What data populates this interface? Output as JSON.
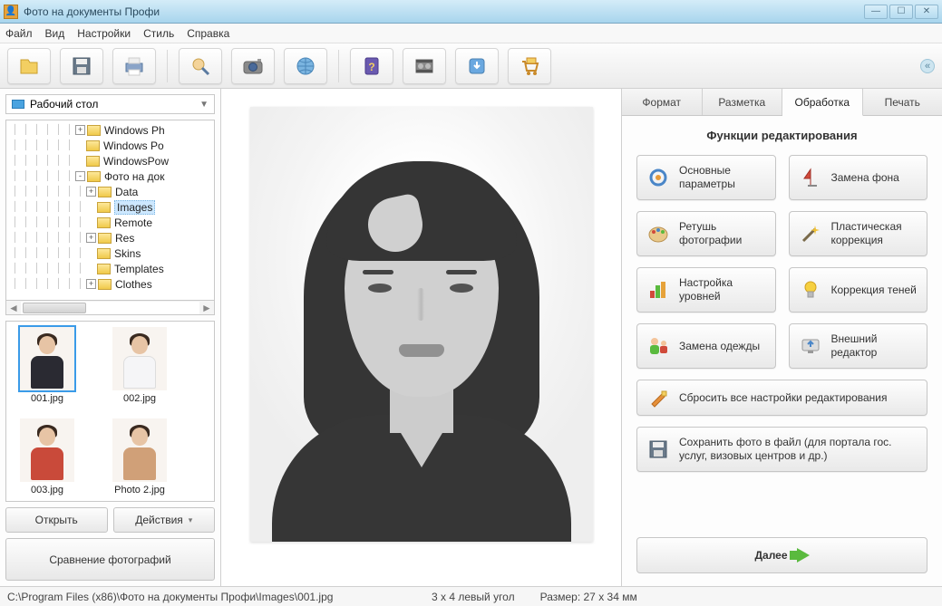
{
  "window": {
    "title": "Фото на документы Профи"
  },
  "menu": {
    "file": "Файл",
    "view": "Вид",
    "settings": "Настройки",
    "style": "Стиль",
    "help": "Справка"
  },
  "folder": {
    "label": "Рабочий стол"
  },
  "tree": [
    {
      "depth": 6,
      "exp": "+",
      "label": "Windows Ph"
    },
    {
      "depth": 6,
      "exp": "",
      "label": "Windows Po"
    },
    {
      "depth": 6,
      "exp": "",
      "label": "WindowsPow"
    },
    {
      "depth": 6,
      "exp": "-",
      "label": "Фото на док"
    },
    {
      "depth": 7,
      "exp": "+",
      "label": "Data"
    },
    {
      "depth": 7,
      "exp": "",
      "label": "Images",
      "sel": true
    },
    {
      "depth": 7,
      "exp": "",
      "label": "Remote"
    },
    {
      "depth": 7,
      "exp": "+",
      "label": "Res"
    },
    {
      "depth": 7,
      "exp": "",
      "label": "Skins"
    },
    {
      "depth": 7,
      "exp": "",
      "label": "Templates"
    },
    {
      "depth": 7,
      "exp": "+",
      "label": "Clothes"
    }
  ],
  "thumbs": [
    {
      "label": "001.jpg",
      "cls": "p-dark",
      "sel": true
    },
    {
      "label": "002.jpg",
      "cls": "p-white"
    },
    {
      "label": "003.jpg",
      "cls": "p-red"
    },
    {
      "label": "Photo 2.jpg",
      "cls": "p-tan"
    }
  ],
  "buttons": {
    "open": "Открыть",
    "actions": "Действия",
    "compare": "Сравнение фотографий"
  },
  "tabs": {
    "format": "Формат",
    "layout": "Разметка",
    "processing": "Обработка",
    "print": "Печать"
  },
  "panel": {
    "heading": "Функции редактирования",
    "basic": "Основные параметры",
    "bg": "Замена фона",
    "retouch": "Ретушь фотографии",
    "plastic": "Пластическая коррекция",
    "levels": "Настройка уровней",
    "shadows": "Коррекция теней",
    "clothes": "Замена одежды",
    "external": "Внешний редактор",
    "reset": "Сбросить все настройки редактирования",
    "save": "Сохранить фото в файл (для портала гос. услуг, визовых центров и др.)",
    "next": "Далее"
  },
  "status": {
    "path": "C:\\Program Files (x86)\\Фото на документы Профи\\Images\\001.jpg",
    "format": "3 x 4 левый угол",
    "size": "Размер: 27 x 34 мм"
  }
}
